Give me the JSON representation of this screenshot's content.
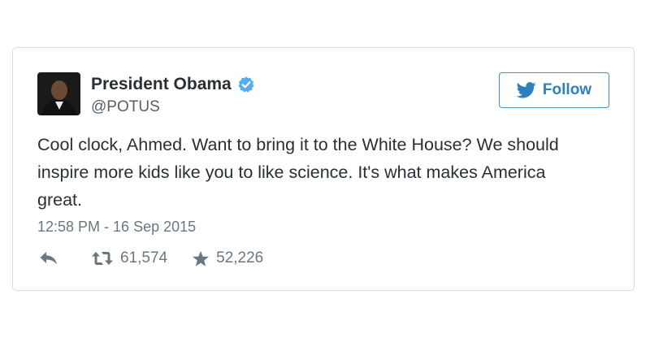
{
  "tweet": {
    "author_name": "President Obama",
    "handle": "@POTUS",
    "text": "Cool clock, Ahmed. Want to bring it to the White House? We should\ninspire more kids like you to like science. It's what makes America\ngreat.",
    "timestamp": "12:58 PM - 16 Sep 2015",
    "retweet_count": "61,574",
    "like_count": "52,226"
  },
  "follow_button": {
    "label": "Follow",
    "icon": "twitter-bird-icon"
  },
  "icons": {
    "verified": "verified-badge-icon",
    "reply": "reply-arrow-icon",
    "retweet": "retweet-icon",
    "like": "star-icon"
  },
  "colors": {
    "accent": "#2c7fc1",
    "verified": "#55acee",
    "text": "#292f33",
    "muted": "#6b7780",
    "border": "#d8dde1"
  }
}
